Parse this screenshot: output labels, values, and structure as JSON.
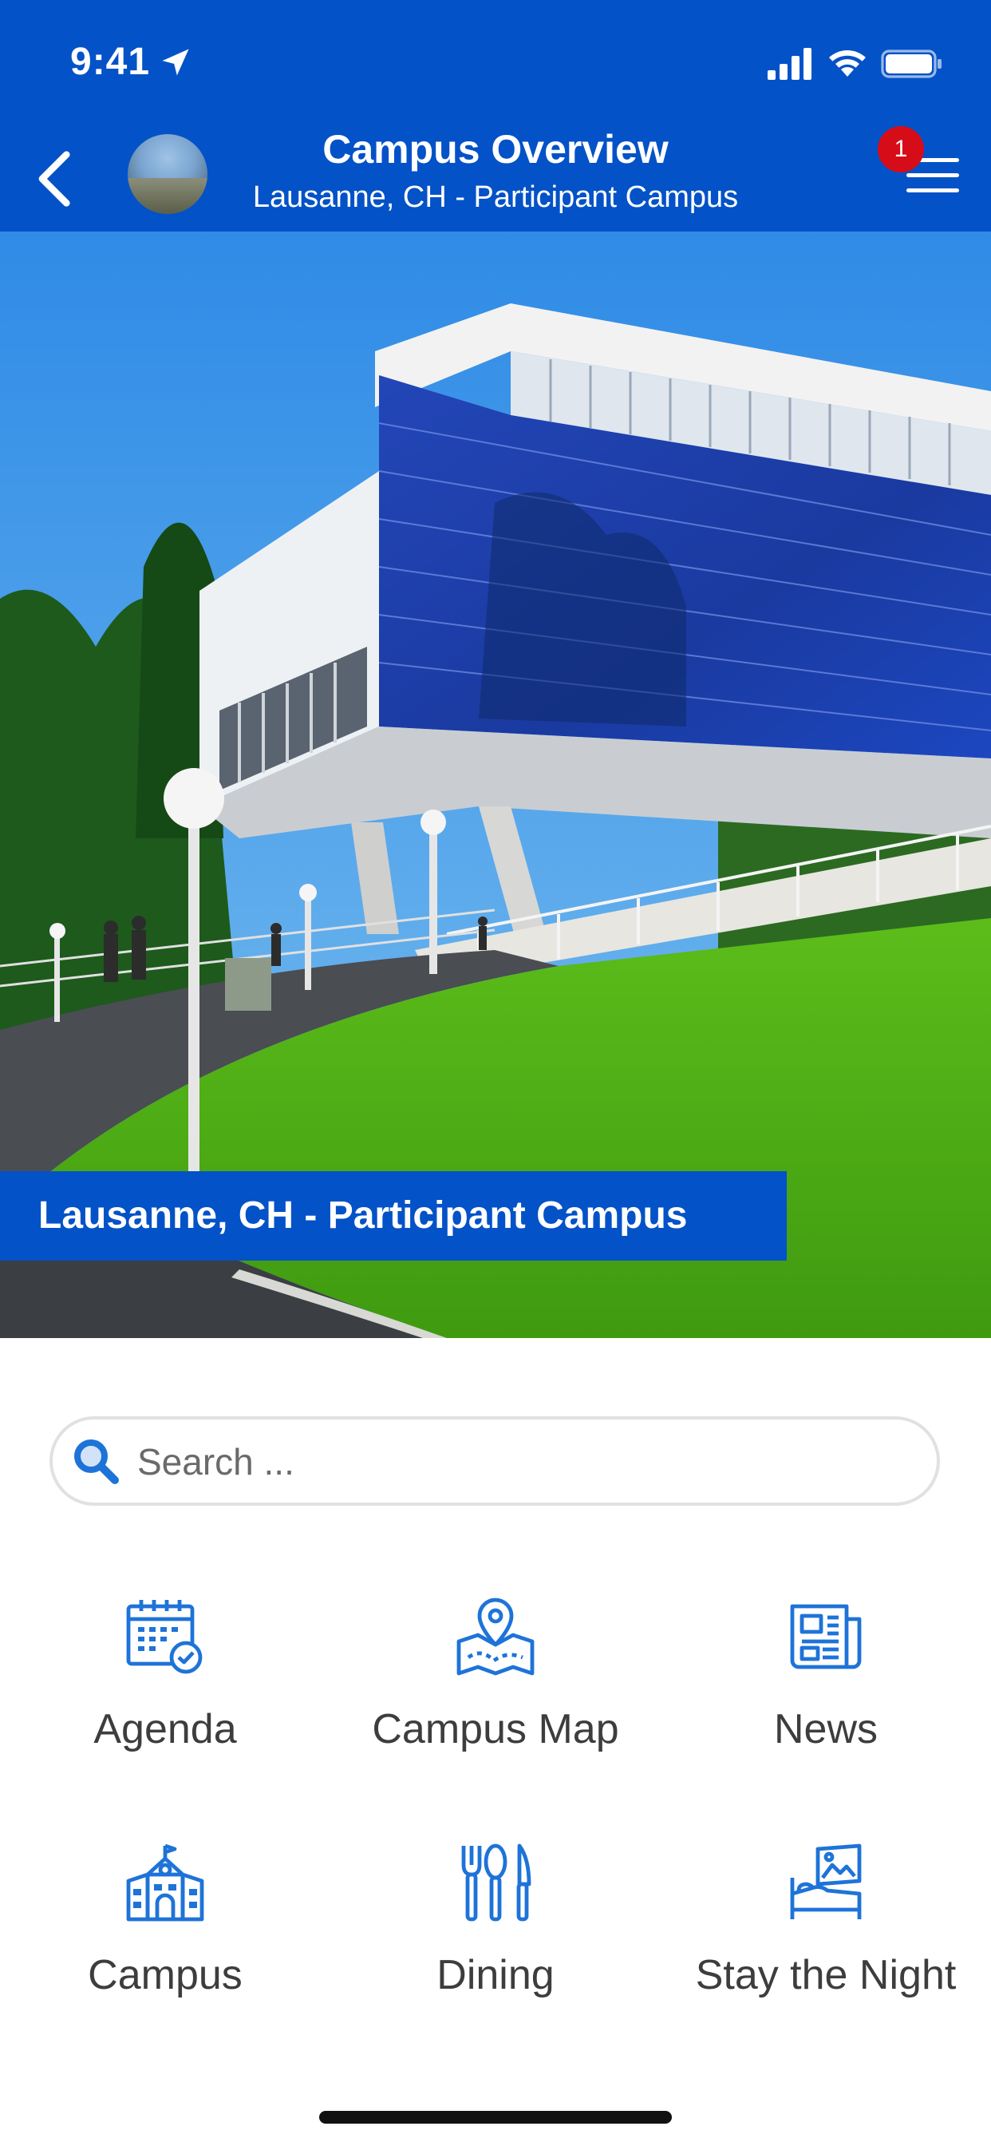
{
  "status": {
    "time": "9:41"
  },
  "header": {
    "title": "Campus Overview",
    "subtitle": "Lausanne, CH - Participant Campus",
    "notification_count": "1"
  },
  "hero": {
    "caption": "Lausanne, CH - Participant Campus"
  },
  "search": {
    "placeholder": "Search ..."
  },
  "tiles": [
    {
      "label": "Agenda",
      "icon": "calendar-check-icon"
    },
    {
      "label": "Campus Map",
      "icon": "map-pin-icon"
    },
    {
      "label": "News",
      "icon": "newspaper-icon"
    },
    {
      "label": "Campus",
      "icon": "school-building-icon"
    },
    {
      "label": "Dining",
      "icon": "fork-spoon-knife-icon"
    },
    {
      "label": "Stay the Night",
      "icon": "bed-icon"
    }
  ],
  "colors": {
    "brand_blue": "#0452c7",
    "icon_blue": "#1e73d8",
    "badge_red": "#d60d18",
    "tile_text": "#3d3d3d"
  }
}
